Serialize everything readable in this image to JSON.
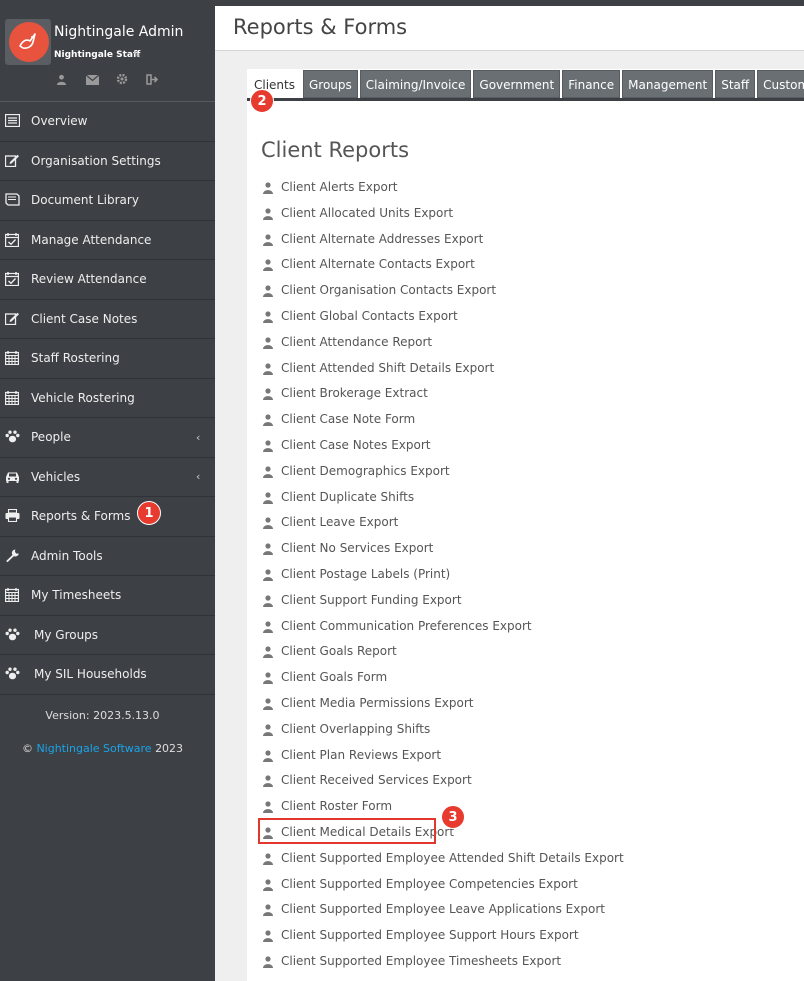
{
  "app": {
    "admin_name": "Nightingale Admin",
    "staff_name": "Nightingale Staff"
  },
  "header": {
    "page_title": "Reports & Forms"
  },
  "sidebar": {
    "items": [
      {
        "label": "Overview",
        "icon": "overview-icon"
      },
      {
        "label": "Organisation Settings",
        "icon": "edit-icon"
      },
      {
        "label": "Document Library",
        "icon": "book-icon"
      },
      {
        "label": "Manage Attendance",
        "icon": "calendar-check-icon"
      },
      {
        "label": "Review Attendance",
        "icon": "calendar-check-icon"
      },
      {
        "label": "Client Case Notes",
        "icon": "edit-icon"
      },
      {
        "label": "Staff Rostering",
        "icon": "calendar-grid-icon"
      },
      {
        "label": "Vehicle Rostering",
        "icon": "calendar-grid-icon"
      },
      {
        "label": "People",
        "icon": "paw-icon",
        "chevron": "‹"
      },
      {
        "label": "Vehicles",
        "icon": "car-icon",
        "chevron": "‹"
      },
      {
        "label": "Reports & Forms",
        "icon": "printer-icon"
      },
      {
        "label": "Admin Tools",
        "icon": "wrench-icon"
      },
      {
        "label": "My Timesheets",
        "icon": "calendar-grid-icon"
      },
      {
        "label": "My Groups",
        "icon": "paw-icon"
      },
      {
        "label": "My SIL Households",
        "icon": "paw-icon"
      }
    ],
    "version": "Version: 2023.5.13.0",
    "copyright_symbol": "©",
    "company_link": "Nightingale Software",
    "year": "2023"
  },
  "tabs": [
    {
      "label": "Clients",
      "active": true
    },
    {
      "label": "Groups"
    },
    {
      "label": "Claiming/Invoice"
    },
    {
      "label": "Government"
    },
    {
      "label": "Finance"
    },
    {
      "label": "Management"
    },
    {
      "label": "Staff"
    },
    {
      "label": "Custom"
    }
  ],
  "section": {
    "title": "Client Reports"
  },
  "reports": [
    "Client Alerts Export",
    "Client Allocated Units Export",
    "Client Alternate Addresses Export",
    "Client Alternate Contacts Export",
    "Client Organisation Contacts Export",
    "Client Global Contacts Export",
    "Client Attendance Report",
    "Client Attended Shift Details Export",
    "Client Brokerage Extract",
    "Client Case Note Form",
    "Client Case Notes Export",
    "Client Demographics Export",
    "Client Duplicate Shifts",
    "Client Leave Export",
    "Client No Services Export",
    "Client Postage Labels (Print)",
    "Client Support Funding Export",
    "Client Communication Preferences Export",
    "Client Goals Report",
    "Client Goals Form",
    "Client Media Permissions Export",
    "Client Overlapping Shifts",
    "Client Plan Reviews Export",
    "Client Received Services Export",
    "Client Roster Form",
    "Client Medical Details Export",
    "Client Supported Employee Attended Shift Details Export",
    "Client Supported Employee Competencies Export",
    "Client Supported Employee Leave Applications Export",
    "Client Supported Employee Support Hours Export",
    "Client Supported Employee Timesheets Export"
  ],
  "annotations": {
    "step1": "1",
    "step2": "2",
    "step3": "3",
    "color": "#e63b2e"
  },
  "colors": {
    "sidebar_bg": "#3d4145",
    "link": "#1aa3e8",
    "highlight": "#e1372c"
  }
}
